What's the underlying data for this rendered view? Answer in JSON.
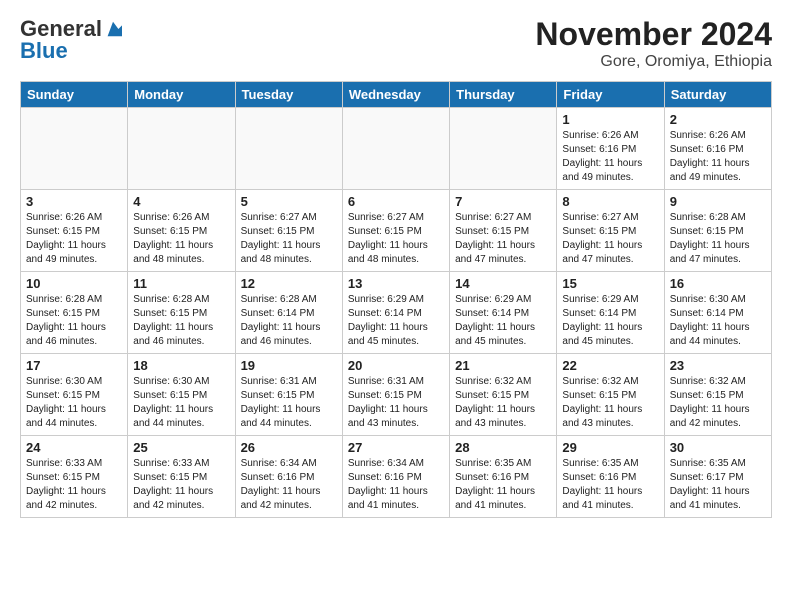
{
  "logo": {
    "general": "General",
    "blue": "Blue"
  },
  "title": "November 2024",
  "location": "Gore, Oromiya, Ethiopia",
  "days_of_week": [
    "Sunday",
    "Monday",
    "Tuesday",
    "Wednesday",
    "Thursday",
    "Friday",
    "Saturday"
  ],
  "weeks": [
    [
      {
        "day": "",
        "info": ""
      },
      {
        "day": "",
        "info": ""
      },
      {
        "day": "",
        "info": ""
      },
      {
        "day": "",
        "info": ""
      },
      {
        "day": "",
        "info": ""
      },
      {
        "day": "1",
        "info": "Sunrise: 6:26 AM\nSunset: 6:16 PM\nDaylight: 11 hours\nand 49 minutes."
      },
      {
        "day": "2",
        "info": "Sunrise: 6:26 AM\nSunset: 6:16 PM\nDaylight: 11 hours\nand 49 minutes."
      }
    ],
    [
      {
        "day": "3",
        "info": "Sunrise: 6:26 AM\nSunset: 6:15 PM\nDaylight: 11 hours\nand 49 minutes."
      },
      {
        "day": "4",
        "info": "Sunrise: 6:26 AM\nSunset: 6:15 PM\nDaylight: 11 hours\nand 48 minutes."
      },
      {
        "day": "5",
        "info": "Sunrise: 6:27 AM\nSunset: 6:15 PM\nDaylight: 11 hours\nand 48 minutes."
      },
      {
        "day": "6",
        "info": "Sunrise: 6:27 AM\nSunset: 6:15 PM\nDaylight: 11 hours\nand 48 minutes."
      },
      {
        "day": "7",
        "info": "Sunrise: 6:27 AM\nSunset: 6:15 PM\nDaylight: 11 hours\nand 47 minutes."
      },
      {
        "day": "8",
        "info": "Sunrise: 6:27 AM\nSunset: 6:15 PM\nDaylight: 11 hours\nand 47 minutes."
      },
      {
        "day": "9",
        "info": "Sunrise: 6:28 AM\nSunset: 6:15 PM\nDaylight: 11 hours\nand 47 minutes."
      }
    ],
    [
      {
        "day": "10",
        "info": "Sunrise: 6:28 AM\nSunset: 6:15 PM\nDaylight: 11 hours\nand 46 minutes."
      },
      {
        "day": "11",
        "info": "Sunrise: 6:28 AM\nSunset: 6:15 PM\nDaylight: 11 hours\nand 46 minutes."
      },
      {
        "day": "12",
        "info": "Sunrise: 6:28 AM\nSunset: 6:14 PM\nDaylight: 11 hours\nand 46 minutes."
      },
      {
        "day": "13",
        "info": "Sunrise: 6:29 AM\nSunset: 6:14 PM\nDaylight: 11 hours\nand 45 minutes."
      },
      {
        "day": "14",
        "info": "Sunrise: 6:29 AM\nSunset: 6:14 PM\nDaylight: 11 hours\nand 45 minutes."
      },
      {
        "day": "15",
        "info": "Sunrise: 6:29 AM\nSunset: 6:14 PM\nDaylight: 11 hours\nand 45 minutes."
      },
      {
        "day": "16",
        "info": "Sunrise: 6:30 AM\nSunset: 6:14 PM\nDaylight: 11 hours\nand 44 minutes."
      }
    ],
    [
      {
        "day": "17",
        "info": "Sunrise: 6:30 AM\nSunset: 6:15 PM\nDaylight: 11 hours\nand 44 minutes."
      },
      {
        "day": "18",
        "info": "Sunrise: 6:30 AM\nSunset: 6:15 PM\nDaylight: 11 hours\nand 44 minutes."
      },
      {
        "day": "19",
        "info": "Sunrise: 6:31 AM\nSunset: 6:15 PM\nDaylight: 11 hours\nand 44 minutes."
      },
      {
        "day": "20",
        "info": "Sunrise: 6:31 AM\nSunset: 6:15 PM\nDaylight: 11 hours\nand 43 minutes."
      },
      {
        "day": "21",
        "info": "Sunrise: 6:32 AM\nSunset: 6:15 PM\nDaylight: 11 hours\nand 43 minutes."
      },
      {
        "day": "22",
        "info": "Sunrise: 6:32 AM\nSunset: 6:15 PM\nDaylight: 11 hours\nand 43 minutes."
      },
      {
        "day": "23",
        "info": "Sunrise: 6:32 AM\nSunset: 6:15 PM\nDaylight: 11 hours\nand 42 minutes."
      }
    ],
    [
      {
        "day": "24",
        "info": "Sunrise: 6:33 AM\nSunset: 6:15 PM\nDaylight: 11 hours\nand 42 minutes."
      },
      {
        "day": "25",
        "info": "Sunrise: 6:33 AM\nSunset: 6:15 PM\nDaylight: 11 hours\nand 42 minutes."
      },
      {
        "day": "26",
        "info": "Sunrise: 6:34 AM\nSunset: 6:16 PM\nDaylight: 11 hours\nand 42 minutes."
      },
      {
        "day": "27",
        "info": "Sunrise: 6:34 AM\nSunset: 6:16 PM\nDaylight: 11 hours\nand 41 minutes."
      },
      {
        "day": "28",
        "info": "Sunrise: 6:35 AM\nSunset: 6:16 PM\nDaylight: 11 hours\nand 41 minutes."
      },
      {
        "day": "29",
        "info": "Sunrise: 6:35 AM\nSunset: 6:16 PM\nDaylight: 11 hours\nand 41 minutes."
      },
      {
        "day": "30",
        "info": "Sunrise: 6:35 AM\nSunset: 6:17 PM\nDaylight: 11 hours\nand 41 minutes."
      }
    ]
  ]
}
